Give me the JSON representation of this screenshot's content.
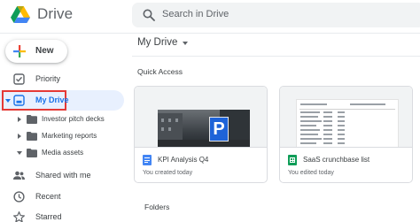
{
  "app": {
    "name": "Drive"
  },
  "search": {
    "placeholder": "Search in Drive"
  },
  "new_button": {
    "label": "New"
  },
  "sidebar": {
    "items": [
      {
        "label": "Priority",
        "icon": "checkbox-icon"
      },
      {
        "label": "My Drive",
        "icon": "my-drive-icon",
        "selected": true
      },
      {
        "label": "Shared with me",
        "icon": "people-icon"
      },
      {
        "label": "Recent",
        "icon": "clock-icon"
      },
      {
        "label": "Starred",
        "icon": "star-icon"
      }
    ],
    "folders": [
      {
        "label": "Investor pitch decks"
      },
      {
        "label": "Marketing reports"
      },
      {
        "label": "Media assets"
      }
    ]
  },
  "main": {
    "title": "My Drive",
    "quick_access_label": "Quick Access",
    "folders_label": "Folders",
    "cards": [
      {
        "title": "KPI Analysis Q4",
        "subtitle": "You created today",
        "icon": "docs-icon",
        "icon_color": "#4285f4"
      },
      {
        "title": "SaaS crunchbase list",
        "subtitle": "You edited today",
        "icon": "sheets-icon",
        "icon_color": "#0f9d58"
      }
    ]
  },
  "colors": {
    "accent": "#1a73e8",
    "selected_bg": "#e8f0fe",
    "highlight_box": "#e53935"
  }
}
